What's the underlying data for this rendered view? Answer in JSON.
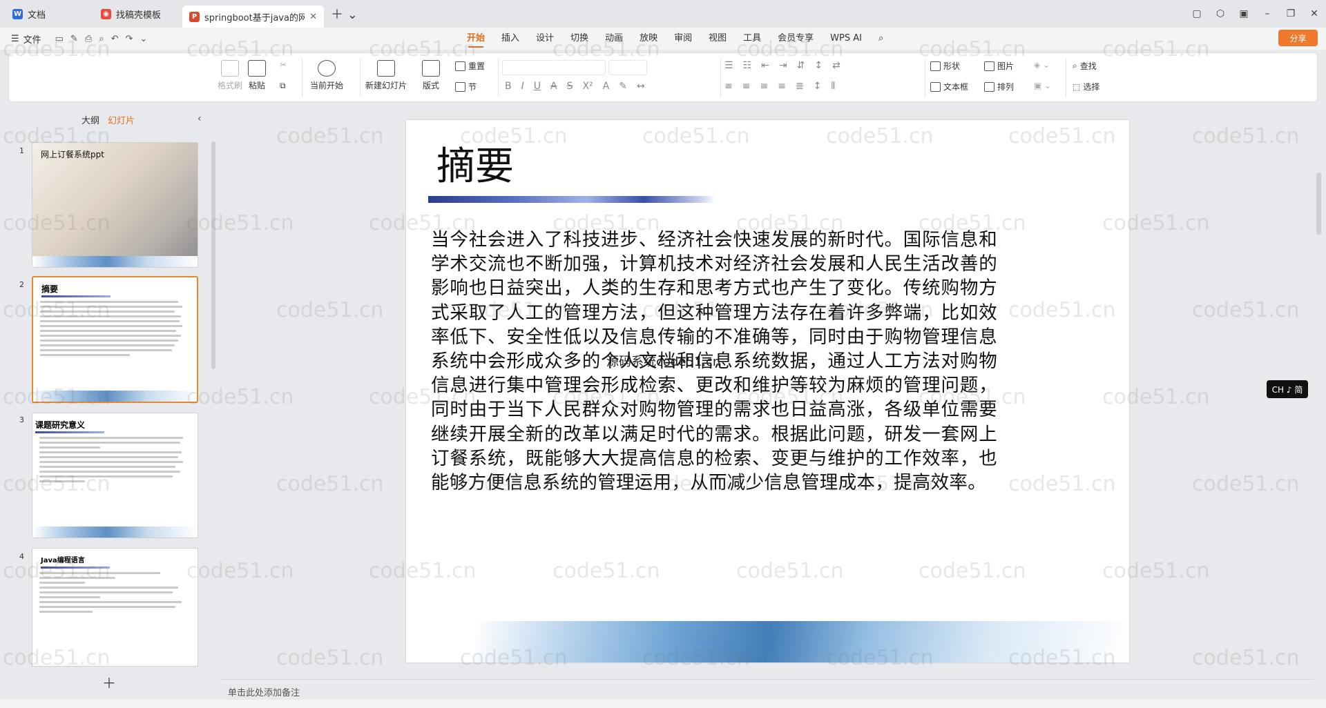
{
  "tabs": [
    {
      "label": "文档",
      "icon": "doc-icon",
      "color": "#2d6be0"
    },
    {
      "label": "找稿壳模板",
      "icon": "template-icon",
      "color": "#e84a3b"
    },
    {
      "label": "springboot基于java的网上订餐",
      "icon": "ppt-icon",
      "color": "#d9492f"
    }
  ],
  "menubar": {
    "file": "文件",
    "tabs": [
      "开始",
      "插入",
      "设计",
      "切换",
      "动画",
      "放映",
      "审阅",
      "视图",
      "工具",
      "会员专享"
    ],
    "active_tab": "开始",
    "wps_ai": "WPS AI",
    "share": "分享"
  },
  "toolbar": {
    "format_painter": "格式刷",
    "paste": "粘贴",
    "start_current": "当前开始",
    "new_slide": "新建幻灯片",
    "layout": "版式",
    "reset": "重置",
    "section": "节",
    "shape": "形状",
    "picture": "图片",
    "textbox": "文本框",
    "arrange": "排列",
    "find": "查找",
    "select": "选择"
  },
  "left_panel": {
    "outline": "大纲",
    "slides": "幻灯片",
    "thumbnails": [
      {
        "num": "1",
        "title": "网上订餐系统ppt"
      },
      {
        "num": "2",
        "title": "摘要"
      },
      {
        "num": "3",
        "title": "课题研究意义"
      },
      {
        "num": "4",
        "title": "Java编程语言"
      }
    ]
  },
  "slide": {
    "title": "摘要",
    "body": "当今社会进入了科技进步、经济社会快速发展的新时代。国际信息和学术交流也不断加强，计算机技术对经济社会发展和人民生活改善的影响也日益突出，人类的生存和思考方式也产生了变化。传统购物方式采取了人工的管理方法，但这种管理方法存在着许多弊端，比如效率低下、安全性低以及信息传输的不准确等，同时由于购物管理信息系统中会形成众多的个人文档和信息系统数据，通过人工方法对购物信息进行集中管理会形成检索、更改和维护等较为麻烦的管理问题，同时由于当下人民群众对购物管理的需求也日益高涨，各级单位需要继续开展全新的改革以满足时代的需求。根据此问题，研发一套网上订餐系统，既能够大大提高信息的检索、变更与维护的工作效率，也能够方便信息系统的管理运用，从而减少信息管理成本，提高效率。",
    "overlap_text": "源码系统code51.cn"
  },
  "notes_placeholder": "单击此处添加备注",
  "ime_badge": "CH ♪ 简",
  "watermark": "code51.cn"
}
